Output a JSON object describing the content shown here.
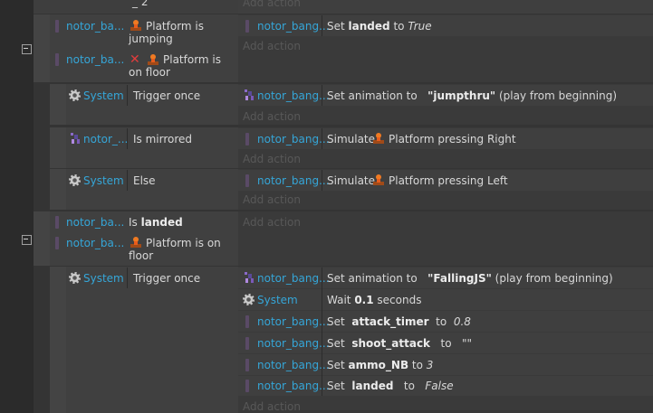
{
  "icons": {
    "gear": "gear-icon",
    "platform": "platform-behavior-icon",
    "sprite": "sprite-object-icon",
    "invert": "red-x-invert-icon",
    "collapse": "collapse-toggle-icon"
  },
  "top": {
    "partial_text": "_ 2",
    "add_action": "Add action"
  },
  "block1": {
    "conditions": [
      {
        "object": "notor_ba...",
        "text": "Platform is jumping"
      },
      {
        "object": "notor_ba...",
        "text": "Platform is on floor"
      }
    ],
    "actions": [
      {
        "object": "notor_bang...",
        "verb": "Set",
        "var": "landed",
        "to": "to",
        "value": "True"
      }
    ],
    "add_action": "Add action"
  },
  "sub1": {
    "condition": {
      "object": "System",
      "text": "Trigger once"
    },
    "action": {
      "object": "notor_bang...",
      "prefix": "Set animation to",
      "anim": "\"jumpthru\"",
      "suffix": "(play from beginning)"
    },
    "add_action": "Add action"
  },
  "sub2": {
    "condition": {
      "object": "notor_...",
      "text": "Is mirrored"
    },
    "action": {
      "object": "notor_bang...",
      "prefix": "Simulate",
      "text": "Platform pressing Right"
    },
    "add_action": "Add action"
  },
  "sub3": {
    "condition": {
      "object": "System",
      "text": "Else"
    },
    "action": {
      "object": "notor_bang...",
      "prefix": "Simulate",
      "text": "Platform pressing Left"
    },
    "add_action": "Add action"
  },
  "block2": {
    "conditions": [
      {
        "object": "notor_ba...",
        "prefix": "Is",
        "var": "landed"
      },
      {
        "object": "notor_ba...",
        "text": "Platform is on floor"
      }
    ],
    "add_action": "Add action"
  },
  "sub4": {
    "condition": {
      "object": "System",
      "text": "Trigger once"
    },
    "actions": [
      {
        "object": "notor_bang...",
        "prefix": "Set animation to",
        "anim": "\"FallingJS\"",
        "suffix": "(play from beginning)"
      },
      {
        "object": "System",
        "prefix": "Wait",
        "num": "0.1",
        "suffix": "seconds"
      },
      {
        "object": "notor_bang...",
        "verb": "Set",
        "var": "attack_timer",
        "to": "to",
        "value": "0.8"
      },
      {
        "object": "notor_bang...",
        "verb": "Set",
        "var": "shoot_attack",
        "to": "to",
        "value": "\"\""
      },
      {
        "object": "notor_bang...",
        "verb": "Set",
        "var": "ammo_NB",
        "to": "to",
        "value": "3"
      },
      {
        "object": "notor_bang...",
        "verb": "Set",
        "var": "landed",
        "to": "to",
        "value": "False"
      }
    ],
    "add_action": "Add action"
  }
}
